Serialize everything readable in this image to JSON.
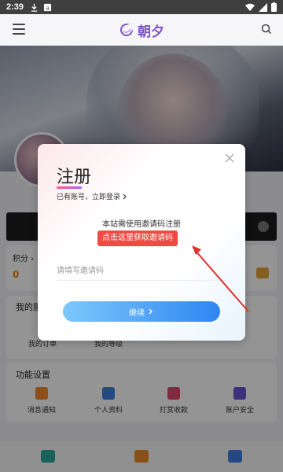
{
  "status_bar": {
    "time": "2:39"
  },
  "header": {
    "logo_text": "朝夕"
  },
  "profile": {
    "points_label": "积分 ›",
    "points_value": "0"
  },
  "my_section": {
    "title": "我的服",
    "items": [
      "我的订单",
      "我的等级"
    ]
  },
  "functions": {
    "title": "功能设置",
    "items": [
      "消息通知",
      "个人资料",
      "打赏收款",
      "账户安全"
    ]
  },
  "dialog": {
    "title": "注册",
    "login_link": "已有账号，立即登录",
    "description": "本站需使用邀请码注册",
    "get_code_button": "点击这里获取邀请码",
    "input_placeholder": "请填写邀请码",
    "continue_button": "继续"
  },
  "colors": {
    "accent_red": "#ef4a43",
    "button_blue": "#2f86f2",
    "logo_purple": "#7c55c4"
  },
  "icons": [
    "menu-icon",
    "search-icon",
    "close-icon",
    "chevron-right-icon",
    "bell-icon",
    "user-icon",
    "gift-icon",
    "shield-icon",
    "home-icon"
  ]
}
